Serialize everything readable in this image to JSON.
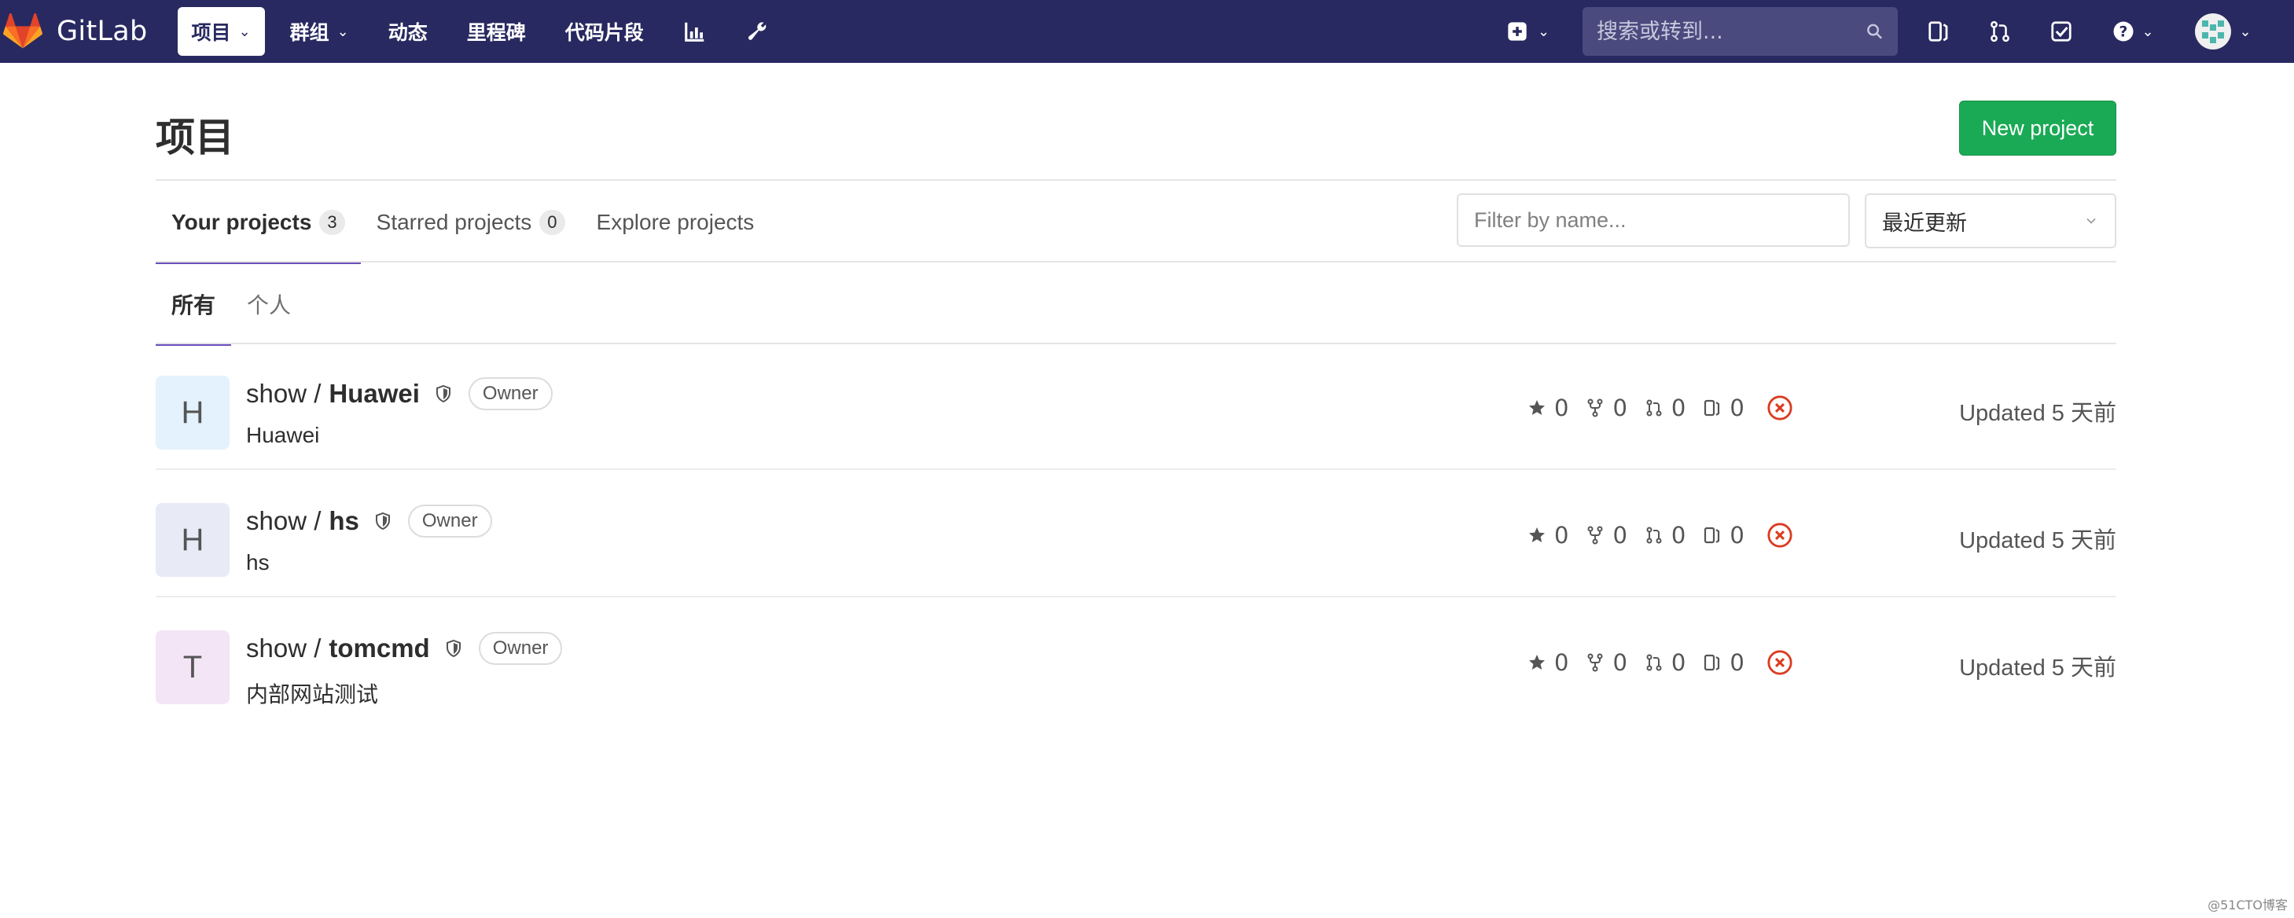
{
  "navbar": {
    "app_name": "GitLab",
    "items": [
      {
        "label": "项目",
        "has_dropdown": true,
        "active": true
      },
      {
        "label": "群组",
        "has_dropdown": true,
        "active": false
      },
      {
        "label": "动态",
        "has_dropdown": false,
        "active": false
      },
      {
        "label": "里程碑",
        "has_dropdown": false,
        "active": false
      },
      {
        "label": "代码片段",
        "has_dropdown": false,
        "active": false
      }
    ],
    "search_placeholder": "搜索或转到...",
    "icons": [
      "chart-icon",
      "wrench-icon",
      "plus-square-icon",
      "search-icon",
      "issues-icon",
      "merge-request-icon",
      "todo-check-icon",
      "help-icon",
      "user-avatar"
    ]
  },
  "header": {
    "title": "项目",
    "new_project_label": "New project"
  },
  "tabs": [
    {
      "label": "Your projects",
      "count": "3",
      "active": true
    },
    {
      "label": "Starred projects",
      "count": "0",
      "active": false
    },
    {
      "label": "Explore projects",
      "count": null,
      "active": false
    }
  ],
  "filter": {
    "placeholder": "Filter by name...",
    "sort_selected": "最近更新"
  },
  "subtabs": [
    {
      "label": "所有",
      "active": true
    },
    {
      "label": "个人",
      "active": false
    }
  ],
  "projects": [
    {
      "avatar_letter": "H",
      "avatar_bg": "#e3f2fd",
      "namespace": "show / ",
      "name": "Huawei",
      "role": "Owner",
      "description": "Huawei",
      "stars": "0",
      "forks": "0",
      "merge_requests": "0",
      "issues": "0",
      "updated": "Updated 5 天前"
    },
    {
      "avatar_letter": "H",
      "avatar_bg": "#e8eaf6",
      "namespace": "show / ",
      "name": "hs",
      "role": "Owner",
      "description": "hs",
      "stars": "0",
      "forks": "0",
      "merge_requests": "0",
      "issues": "0",
      "updated": "Updated 5 天前"
    },
    {
      "avatar_letter": "T",
      "avatar_bg": "#f3e5f5",
      "namespace": "show / ",
      "name": "tomcmd",
      "role": "Owner",
      "description": "内部网站测试",
      "stars": "0",
      "forks": "0",
      "merge_requests": "0",
      "issues": "0",
      "updated": "Updated 5 天前"
    }
  ],
  "colors": {
    "navbar_bg": "#292961",
    "accent": "#6b4fbb",
    "new_project_bg": "#1aaa55",
    "pipeline_failed": "#db3b21"
  },
  "watermark": "@51CTO博客"
}
